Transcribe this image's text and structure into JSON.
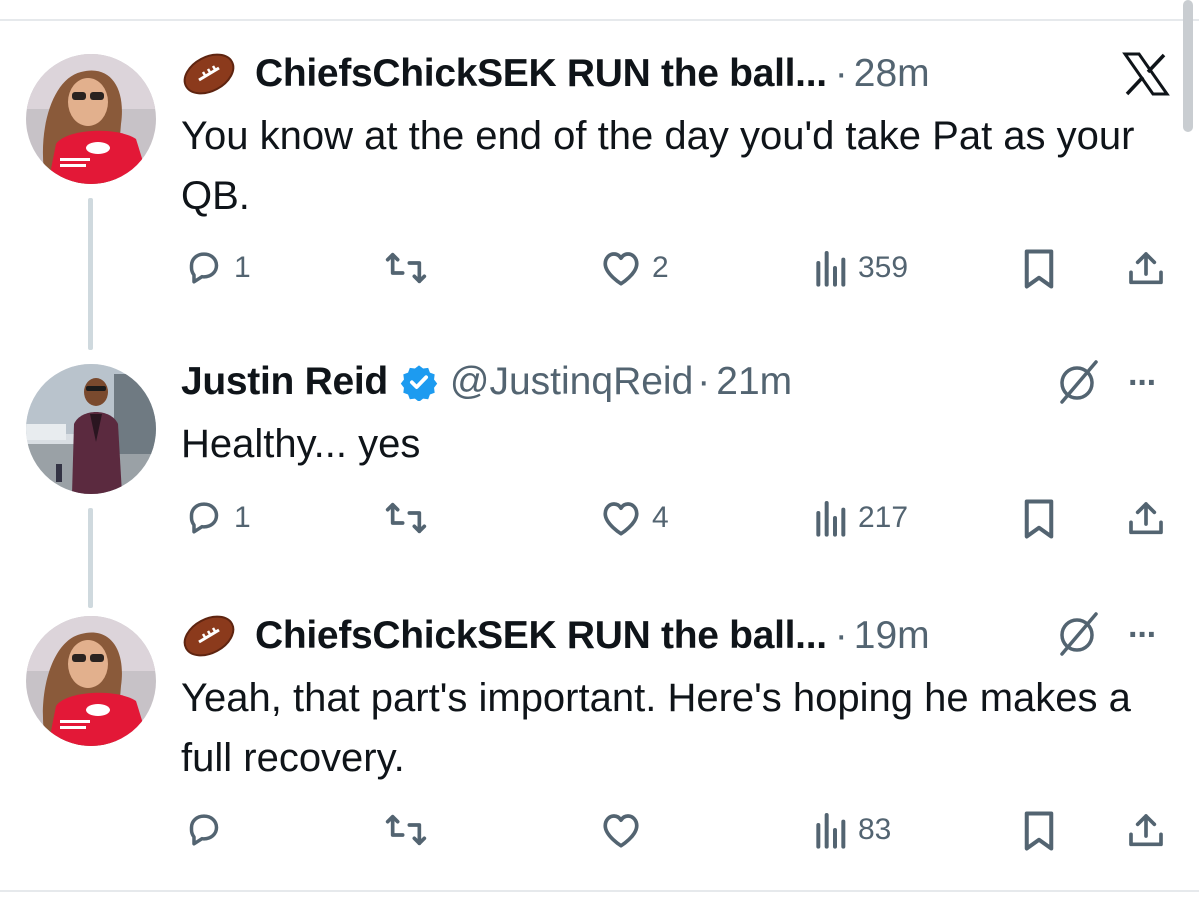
{
  "icons": {
    "x_logo": "x-logo-icon",
    "more": "more-icon",
    "grok": "grok-icon",
    "reply": "reply-icon",
    "retweet": "retweet-icon",
    "like": "heart-icon",
    "views": "views-icon",
    "bookmark": "bookmark-icon",
    "share": "share-icon",
    "verified": "verified-badge-icon",
    "football": "football-emoji-icon"
  },
  "colors": {
    "verified": "#1d9bf0",
    "secondary_text": "#536471",
    "thread_line": "#cfd9de",
    "chiefs_red": "#e31837"
  },
  "more_label": "···",
  "tweets": [
    {
      "name": "ChiefsChickSEK RUN the ball...",
      "handle": "",
      "separator": "·",
      "time": "28m",
      "text": "You know at the end of the day you'd take Pat as your QB.",
      "replies": "1",
      "retweets": "",
      "likes": "2",
      "views": "359"
    },
    {
      "name": "Justin Reid",
      "handle": "@JustinqReid",
      "separator": "·",
      "time": "21m",
      "text": "Healthy... yes",
      "replies": "1",
      "retweets": "",
      "likes": "4",
      "views": "217"
    },
    {
      "name": "ChiefsChickSEK RUN the ball...",
      "handle": "",
      "separator": "·",
      "time": "19m",
      "text": "Yeah, that part's important. Here's hoping he makes a full recovery.",
      "replies": "",
      "retweets": "",
      "likes": "",
      "views": "83"
    }
  ]
}
